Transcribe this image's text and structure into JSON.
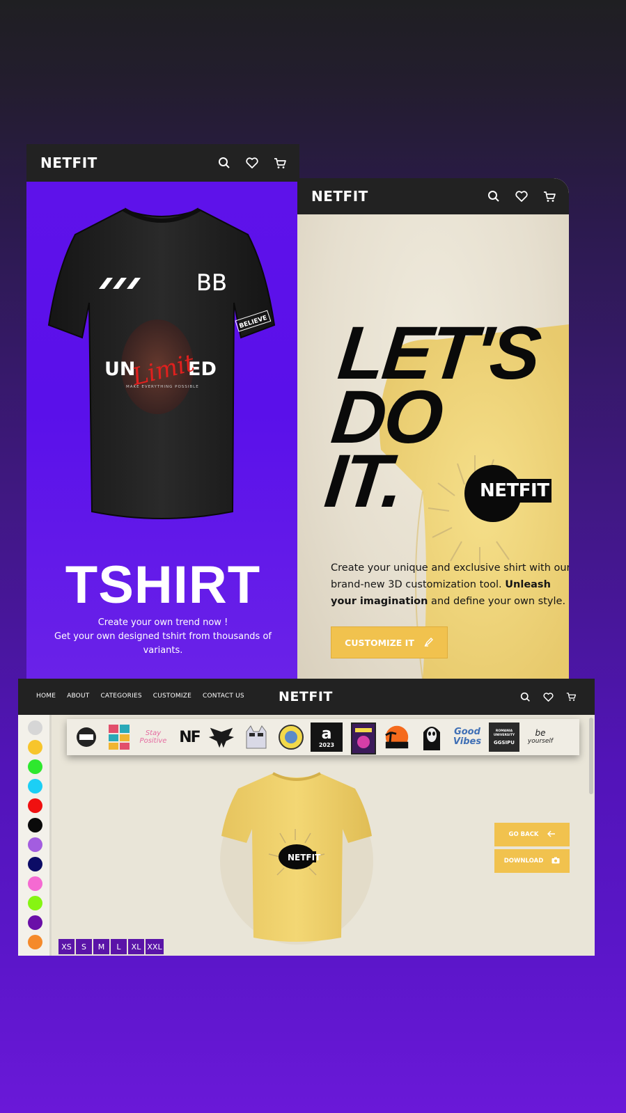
{
  "colors": {
    "purple": "#5f12ea",
    "nav_bg": "#222222",
    "accent_yellow": "#f1c24e",
    "cream": "#e9e5d8"
  },
  "card1": {
    "brand": "NETFIT",
    "icons": [
      "search-icon",
      "heart-icon",
      "cart-icon"
    ],
    "shirt_print": {
      "logo_text": "BB",
      "word_left": "UN",
      "word_script": "Limit",
      "word_right": "ED",
      "tagline": "MAKE EVERYTHING POSSIBLE",
      "sleeve": "BELIEVE"
    },
    "title": "TSHIRT",
    "subtitle_line1": "Create your own trend now !",
    "subtitle_line2": "Get your own designed tshirt from thousands of",
    "subtitle_line3": "variants."
  },
  "card2": {
    "brand": "NETFIT",
    "headline_1": "LET'S",
    "headline_2": "DO",
    "headline_3": "IT.",
    "badge": "NETFIT",
    "desc_part1": "Create your unique and exclusive shirt with our brand-new 3D customization tool. ",
    "desc_bold1": "Unleash your imagination",
    "desc_part2": " and define your own style.",
    "button": "CUSTOMIZE IT"
  },
  "card3": {
    "menu": [
      "HOME",
      "ABOUT",
      "CATEGORIES",
      "CUSTOMIZE",
      "CONTACT US"
    ],
    "brand": "NETFIT",
    "swatches": [
      "#d6d6d6",
      "#f7c52b",
      "#2ee82e",
      "#1ccff5",
      "#f01010",
      "#0a0a0a",
      "#a35de0",
      "#0c0c66",
      "#f56ad2",
      "#86f512",
      "#6a0fa8",
      "#f58a2a"
    ],
    "decals": [
      "netfit-logo",
      "color-blocks",
      "stay-positive",
      "nf-monogram",
      "eagle",
      "cat-with-glasses",
      "circle-badge",
      "letter-a-2023",
      "poster",
      "sunset-palms",
      "ghost-face",
      "good-vibes",
      "romania-university",
      "be-yourself"
    ],
    "decal_texts": {
      "stay_positive": "Stay Positive",
      "nf": "NF",
      "a": "a",
      "year": "2023",
      "good": "Good",
      "vibes": "Vibes",
      "uni": "ROMANIA UNIVERSITY",
      "ggsipu": "GGSIPU",
      "be": "be",
      "yourself": "yourself"
    },
    "shirt_badge": "NETFIT",
    "go_back": "GO BACK",
    "download": "DOWNLOAD",
    "sizes": [
      "XS",
      "S",
      "M",
      "L",
      "XL",
      "XXL"
    ]
  }
}
